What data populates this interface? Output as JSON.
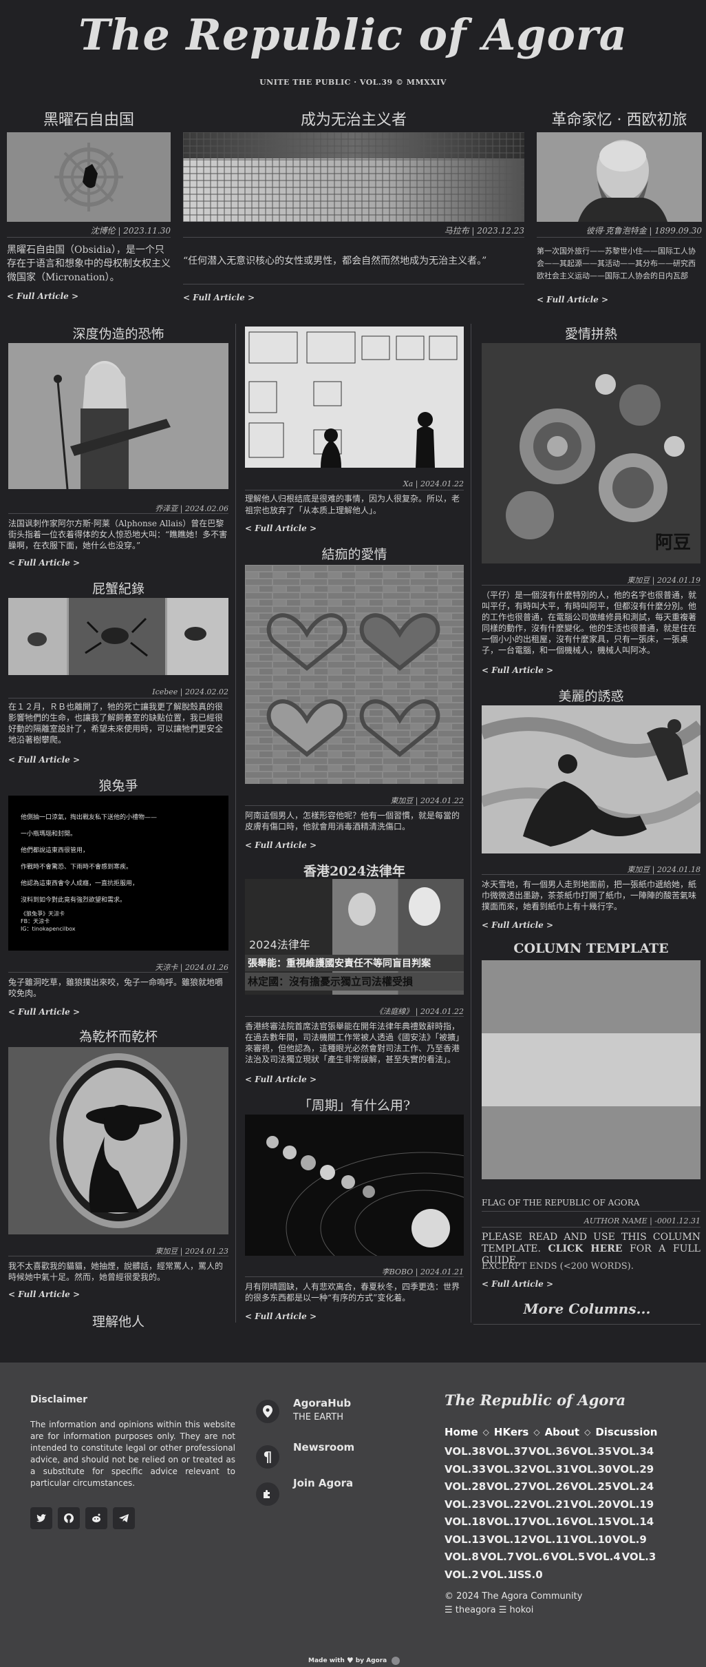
{
  "masthead": {
    "title": "The Republic of Agora",
    "tagline": "UNITE THE PUBLIC · VOL.39 © MMXXIV"
  },
  "top": [
    {
      "title": "黑曜石自由国",
      "byline": "沈博伦 | 2023.11.30",
      "excerpt": "黑曜石自由国（Obsidia），是一个只存在于语言和想象中的母权制女权主义微国家（Micronation）。",
      "more": "< Full Article >"
    },
    {
      "title": "成为无治主义者",
      "byline": "马拉布 | 2023.12.23",
      "excerpt": "“任何潜入无意识核心的女性或男性，都会自然而然地成为无治主义者。”",
      "more": "< Full Article >"
    },
    {
      "title": "革命家忆 · 西欧初旅",
      "byline": "彼得·克鲁泡特金 | 1899.09.30",
      "excerpt": "第一次国外旅行——苏黎世小住——国际工人协会——其起源——其活动——其分布——研究西欧社会主义运动——国际工人协会的日内瓦部",
      "more": "< Full Article >"
    }
  ],
  "col1": [
    {
      "title": "深度伪造的恐怖",
      "byline": "乔泽亚 | 2024.02.06",
      "excerpt": "法国讽刺作家阿尔方斯·阿莱（Alphonse Allais）曾在巴黎街头指着一位衣着得体的女人惊恐地大叫：“瞧瞧她！多不害臊啊，在衣服下面，她什么也没穿。”",
      "more": "< Full Article >"
    },
    {
      "title": "屁蟹紀錄",
      "byline": "Icebee | 2024.02.02",
      "excerpt": "在１２月，ＲＢ也離開了，牠的死亡讓我更了解脫殼真的很影響牠們的生命，也讓我了解飼養室的缺點位置，我已經很好動的隔離室設計了，希望未來使用時，可以讓牠們更安全地沿著樹攀爬。",
      "more": "< Full Article >"
    },
    {
      "title": "狼兔爭",
      "byline": "天涼卡 | 2024.01.26",
      "excerpt": "兔子雖洞吃草，雖狼撲出來咬，兔子一命嗚呼。雖狼就地嚼咬免肉。",
      "more": "< Full Article >",
      "poem": [
        "他側抽一口涼氣，掏出戰友私下送他的小禮物——",
        "一小瓶瑪瑙和封開。",
        "他們都說這東西很管用，",
        "作戰時不會驚恐、下雨時不會感到寒疾。",
        "他認為這東西會令人成癮，一直抗拒服用，",
        "沒料到如今對此竟有強烈欲望和需求。",
        "《狼兔爭》天涼卡",
        "FB：天涼卡",
        "IG：tinokapencilbox"
      ]
    },
    {
      "title": "為乾杯而乾杯",
      "byline": "東加豆 | 2024.01.23",
      "excerpt": "我不太喜歡我的貓貓，她抽煙，說髒話，經常罵人，罵人的時候她中氣十足。然而，她曾經很愛我的。",
      "more": "< Full Article >"
    },
    {
      "title": "理解他人"
    }
  ],
  "col2": [
    {
      "byline": "Xa | 2024.01.22",
      "excerpt": "理解他人归根结底是很难的事情，因为人很复杂。所以，老祖宗也放弃了「从本质上理解他人」。",
      "more": "< Full Article >"
    },
    {
      "title": "結痂的愛情",
      "byline": "東加豆 | 2024.01.22",
      "excerpt": "阿南這個男人，怎樣形容他呢？他有一個習慣，就是每當的皮膚有傷口時，他就會用消毒酒精清洗傷口。",
      "more": "< Full Article >"
    },
    {
      "title": "香港2024法律年",
      "byline": "《法庭線》 | 2024.01.22",
      "excerpt": "香港終審法院首席法官張舉能在開年法律年典禮致辭時指，在過去數年間，司法機關工作常被人透過《國安法》「被擴」來審視，但他認為，這種眼光必然會對司法工作、乃至香港法治及司法獨立現狀「產生非常誤解，甚至失實的看法」。",
      "more": "< Full Article >",
      "banner": "2024法律年",
      "caption1": "張舉能：重視維護國安責任不等同盲目判案",
      "caption2": "林定國：沒有擔憂示獨立司法權受損"
    },
    {
      "title": "「周期」有什么用?",
      "byline": "李BOBO | 2024.01.21",
      "excerpt": "月有阴晴圆缺，人有悲欢离合，春夏秋冬，四季更迭：世界的很多东西都是以一种“有序的方式”变化着。",
      "more": "< Full Article >"
    }
  ],
  "col3": [
    {
      "title": "愛情拼熱",
      "byline": "東加豆 | 2024.01.19",
      "excerpt": "（平仔）是一個沒有什麼特別的人，他的名字也很普通，就叫平仔，有時叫大平，有時叫阿平，但都沒有什麼分別。他的工作也很普通，在電腦公司做維修員和測試，每天重複著同樣的動作，沒有什麼變化。他的生活也很普通，就是住在一個小小的出租屋，沒有什麼家具，只有一張床，一張桌子，一台電腦，和一個機械人，機械人叫阿冰。",
      "more": "< Full Article >",
      "signature": "阿豆"
    },
    {
      "title": "美麗的誘惑",
      "byline": "東加豆 | 2024.01.18",
      "excerpt": "冰天雪地，有一個男人走到地面前，把一張紙巾遞給她，紙巾微微透出墨跡，茶茶紙巾打開了紙巾，一陣陣的酸苦氣味撲面而來，她看到紙巾上有十幾行字。",
      "more": "< Full Article >"
    },
    {
      "title": "COLUMN TEMPLATE",
      "caption": "FLAG OF THE REPUBLIC OF AGORA",
      "byline": "AUTHOR NAME | -0001.12.31",
      "excerpt_pre": "PLEASE READ AND USE THIS COLUMN TEMPLATE. ",
      "excerpt_link": "CLICK HERE",
      "excerpt_post": " FOR A FULL GUIDE.",
      "note": "EXCERPT ENDS (<200 WORDS).",
      "more": "< Full Article >"
    },
    {
      "title": "More Columns..."
    }
  ],
  "footer": {
    "disclaimer_title": "Disclaimer",
    "disclaimer_text": "The information and opinions within this website are for information purposes only. They are not intended to constitute legal or other professional advice, and should not be relied on or treated as a substitute for specific advice relevant to particular circumstances.",
    "contacts": [
      {
        "label": "AgoraHub",
        "sub": "THE EARTH",
        "icon": "location-pin-icon"
      },
      {
        "label": "Newsroom",
        "icon": "paragraph-icon"
      },
      {
        "label": "Join Agora",
        "icon": "puzzle-icon"
      }
    ],
    "brand": "The Republic of Agora",
    "nav": [
      "Home",
      "HKers",
      "About",
      "Discussion"
    ],
    "nav_sep": "◇",
    "vol_rows": [
      [
        "VOL.38",
        "VOL.37",
        "VOL.36",
        "VOL.35",
        "VOL.34"
      ],
      [
        "VOL.33",
        "VOL.32",
        "VOL.31",
        "VOL.30",
        "VOL.29"
      ],
      [
        "VOL.28",
        "VOL.27",
        "VOL.26",
        "VOL.25",
        "VOL.24"
      ],
      [
        "VOL.23",
        "VOL.22",
        "VOL.21",
        "VOL.20",
        "VOL.19"
      ],
      [
        "VOL.18",
        "VOL.17",
        "VOL.16",
        "VOL.15",
        "VOL.14"
      ],
      [
        "VOL.13",
        "VOL.12",
        "VOL.11",
        "VOL.10",
        "VOL.9"
      ],
      [
        "VOL.8",
        "VOL.7",
        "VOL.6",
        "VOL.5",
        "VOL.4",
        "VOL.3"
      ],
      [
        "VOL.2",
        "VOL.1",
        "ISS.0"
      ]
    ],
    "copyright": "© 2024 The Agora Community",
    "credits": "☰ theagora ☰ hokoi",
    "made_with_pre": "Made with",
    "made_with_post": "by Agora",
    "socials": [
      "twitter-icon",
      "github-icon",
      "reddit-icon",
      "telegram-icon"
    ]
  },
  "colors": {
    "bg": "#212124",
    "footer_bg": "#414143",
    "text": "#d4d4d4"
  }
}
